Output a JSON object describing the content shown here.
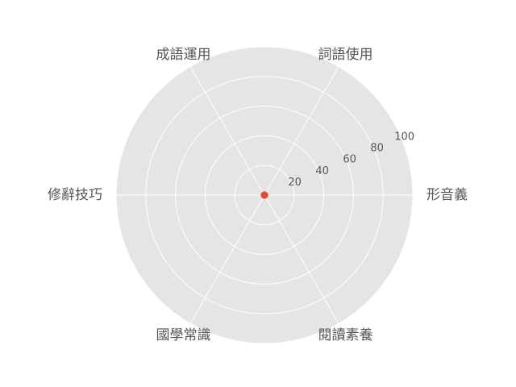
{
  "chart_data": {
    "type": "radar",
    "categories": [
      "形音義",
      "詞語使用",
      "成語運用",
      "修辭技巧",
      "國學常識",
      "閱讀素養"
    ],
    "series": [
      {
        "values": [
          0,
          0,
          0,
          0,
          0,
          0
        ]
      }
    ],
    "r_ticks": [
      "20",
      "40",
      "60",
      "80",
      "100"
    ],
    "r_tick_values": [
      20,
      40,
      60,
      80,
      100
    ],
    "rlim": [
      0,
      100
    ],
    "grid": true,
    "colors": {
      "background": "#e5e5e5",
      "grid": "#ffffff",
      "series": "#e24a33",
      "text": "#555555"
    }
  }
}
